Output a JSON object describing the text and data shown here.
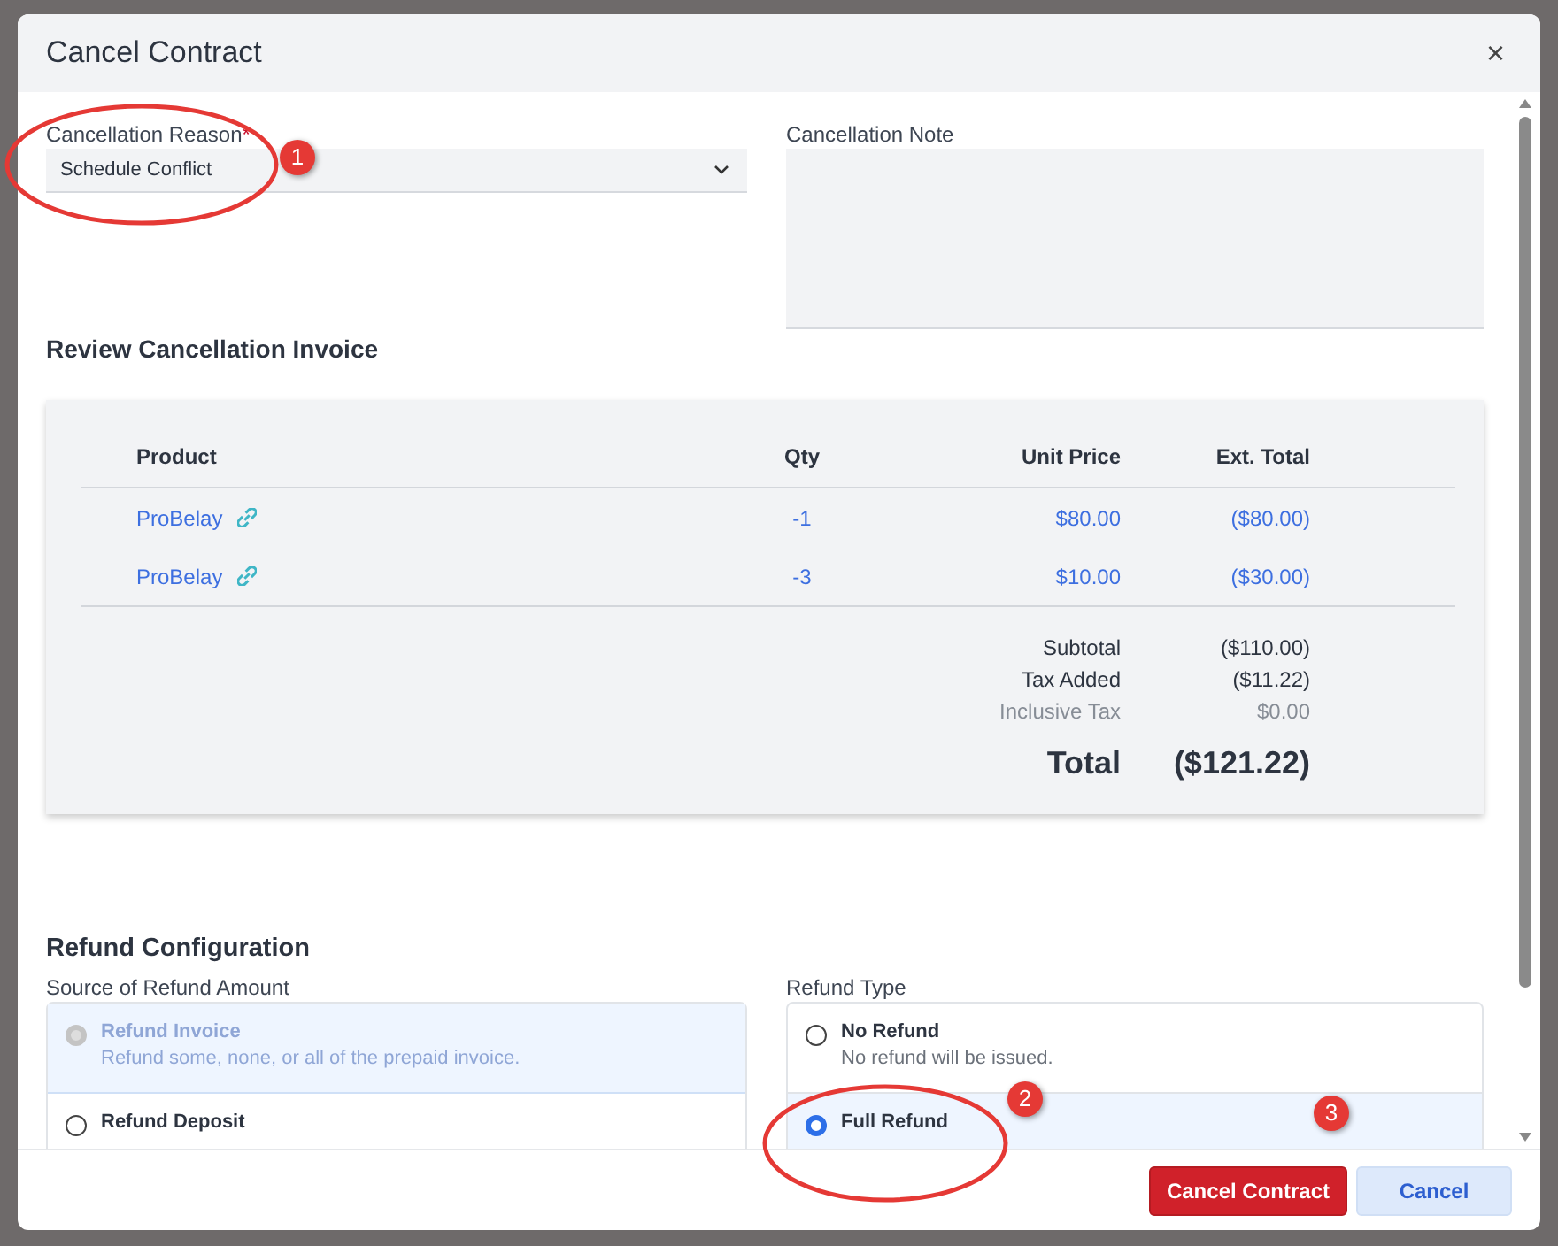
{
  "window": {
    "title": "Cancel Contract",
    "close": "×"
  },
  "reason": {
    "label": "Cancellation Reason",
    "required_mark": "*",
    "value": "Schedule Conflict"
  },
  "note": {
    "label": "Cancellation Note"
  },
  "invoice": {
    "title": "Review Cancellation Invoice",
    "columns": [
      "Product",
      "Qty",
      "Unit Price",
      "Ext. Total"
    ],
    "rows": [
      {
        "product": "ProBelay",
        "qty": "-1",
        "unit_price": "$80.00",
        "ext_total": "($80.00)"
      },
      {
        "product": "ProBelay",
        "qty": "-3",
        "unit_price": "$10.00",
        "ext_total": "($30.00)"
      }
    ],
    "summary": [
      {
        "label": "Subtotal",
        "value": "($110.00)",
        "kind": "normal"
      },
      {
        "label": "Tax Added",
        "value": "($11.22)",
        "kind": "normal"
      },
      {
        "label": "Inclusive Tax",
        "value": "$0.00",
        "kind": "muted"
      },
      {
        "label": "Total",
        "value": "($121.22)",
        "kind": "total"
      }
    ]
  },
  "refund": {
    "title": "Refund Configuration",
    "source": {
      "label": "Source of Refund Amount",
      "options": [
        {
          "title": "Refund Invoice",
          "description": "Refund some, none, or all of the prepaid invoice.",
          "selected": true,
          "disabled": true
        },
        {
          "title": "Refund Deposit",
          "selected": false,
          "disabled": false
        }
      ]
    },
    "type": {
      "label": "Refund Type",
      "options": [
        {
          "title": "No Refund",
          "description": "No refund will be issued.",
          "selected": false,
          "disabled": false
        },
        {
          "title": "Full Refund",
          "selected": true,
          "disabled": false
        }
      ]
    }
  },
  "buttons": [
    {
      "label": "Cancel Contract",
      "kind": "danger"
    },
    {
      "label": "Cancel",
      "kind": "secondary"
    }
  ],
  "callouts": [
    {
      "number": "1",
      "ellipse": true
    },
    {
      "number": "2",
      "ellipse": true
    },
    {
      "number": "3",
      "ellipse": false
    }
  ]
}
